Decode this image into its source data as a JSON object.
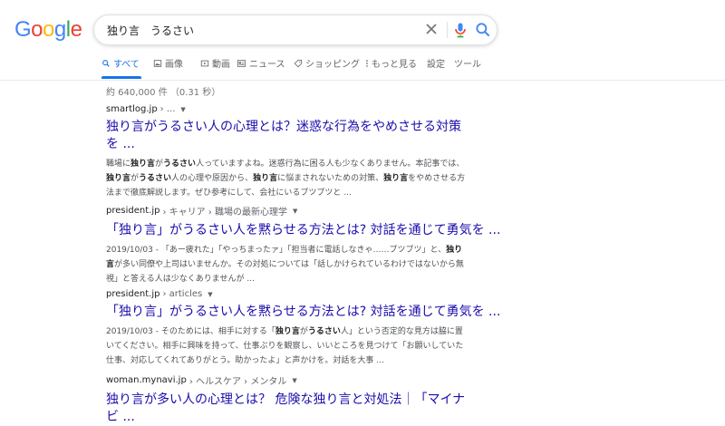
{
  "header": {
    "logo": [
      "G",
      "o",
      "o",
      "g",
      "l",
      "e"
    ],
    "logo_colors": [
      "#4285f4",
      "#ea4335",
      "#fbbc05",
      "#4285f4",
      "#34a853",
      "#ea4335"
    ],
    "query": "独り言　うるさい"
  },
  "tabs": [
    {
      "label": "すべて",
      "icon": "search-icon"
    },
    {
      "label": "画像",
      "icon": "image-icon"
    },
    {
      "label": "動画",
      "icon": "video-icon"
    },
    {
      "label": "ニュース",
      "icon": "news-icon"
    },
    {
      "label": "ショッピング",
      "icon": "tag-icon"
    },
    {
      "label": "もっと見る",
      "icon": "more-vert-icon"
    },
    {
      "label": "設定",
      "icon": ""
    },
    {
      "label": "ツール",
      "icon": ""
    }
  ],
  "stats": "約 640,000 件 （0.31 秒）",
  "results": [
    {
      "domain": "smartlog.jp",
      "path": " › ...",
      "title": "独り言がうるさい人の心理とは？迷惑な行為をやめさせる対策を ...",
      "snippet": [
        [
          "職場に",
          ""
        ],
        [
          "独り言",
          "b"
        ],
        [
          "が",
          ""
        ],
        [
          "うるさい",
          "b"
        ],
        [
          "人っていますよね。迷惑行為に困る人も少なくありません。本記事では、",
          ""
        ],
        [
          "独り言",
          "b"
        ],
        [
          "が",
          ""
        ],
        [
          "うるさい",
          "b"
        ],
        [
          "人の心理や原因から、",
          ""
        ],
        [
          "独り言",
          "b"
        ],
        [
          "に悩まされないための対策、",
          ""
        ],
        [
          "独り言",
          "b"
        ],
        [
          "をやめさせる方法まで徹底解説します。ぜひ参考にして、会社にいるブツブツと ...",
          ""
        ]
      ]
    },
    {
      "domain": "president.jp",
      "path": " › キャリア › 職場の最新心理学",
      "title": "「独り言」がうるさい人を黙らせる方法とは? 対話を通じて勇気を ...",
      "snippet": [
        [
          "2019/10/03 - 「あー疲れた」「やっちまったァ」「担当者に電話しなきゃ……ブツブツ」と、",
          ""
        ],
        [
          "独り言",
          "b"
        ],
        [
          "が多い同僚や上司はいませんか。その対処については「話しかけられているわけではないから無視」と答える人は少なくありませんが ...",
          ""
        ]
      ]
    },
    {
      "domain": "president.jp",
      "path": " › articles",
      "title": "「独り言」がうるさい人を黙らせる方法とは? 対話を通じて勇気を ...",
      "snippet": [
        [
          "2019/10/03 - そのためには、相手に対する「",
          ""
        ],
        [
          "独り言",
          "b"
        ],
        [
          "が",
          ""
        ],
        [
          "うるさい",
          "b"
        ],
        [
          "人」という否定的な見方は脇に置いてください。相手に興味を持って、仕事ぶりを観察し、いいところを見つけて「お願いしていた仕事、対応してくれてありがとう。助かったよ」と声かけを。対話を大事 ...",
          ""
        ]
      ]
    },
    {
      "domain": "woman.mynavi.jp",
      "path": " › ヘルスケア › メンタル",
      "title": "独り言が多い人の心理とは？ 危険な独り言と対処法｜「マイナビ ...",
      "snippet": []
    }
  ]
}
